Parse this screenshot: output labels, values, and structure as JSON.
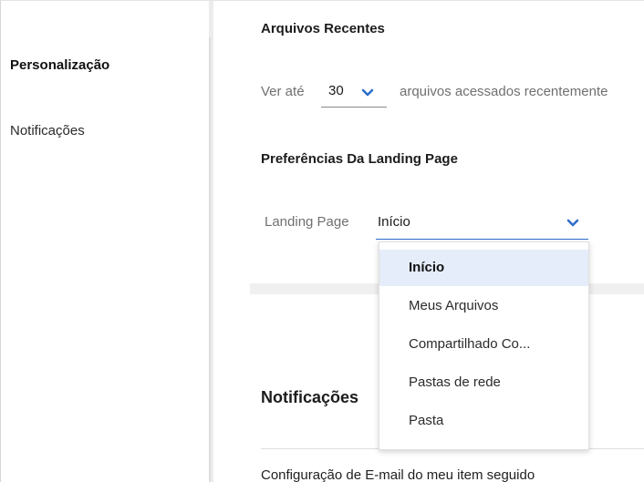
{
  "sidebar": {
    "items": [
      {
        "label": "Personalização",
        "active": true
      },
      {
        "label": "Notificações",
        "active": false
      }
    ]
  },
  "recent_files": {
    "title": "Arquivos Recentes",
    "prefix": "Ver até",
    "count_value": "30",
    "suffix": "arquivos acessados recentemente"
  },
  "landing": {
    "title": "Preferências Da Landing Page",
    "label": "Landing Page",
    "value": "Início",
    "options": [
      "Início",
      "Meus Arquivos",
      "Compartilhado Co...",
      "Pastas de rede",
      "Pasta"
    ],
    "selected_index": 0
  },
  "notifications": {
    "title": "Notificações",
    "email_config": "Configuração de E-mail do meu item seguido"
  },
  "colors": {
    "accent": "#2f6ecb",
    "selected_bg": "#e4edf9",
    "muted_text": "#707070"
  },
  "icons": {
    "count_chevron": "chevron-down-icon",
    "landing_chevron": "chevron-down-icon"
  }
}
